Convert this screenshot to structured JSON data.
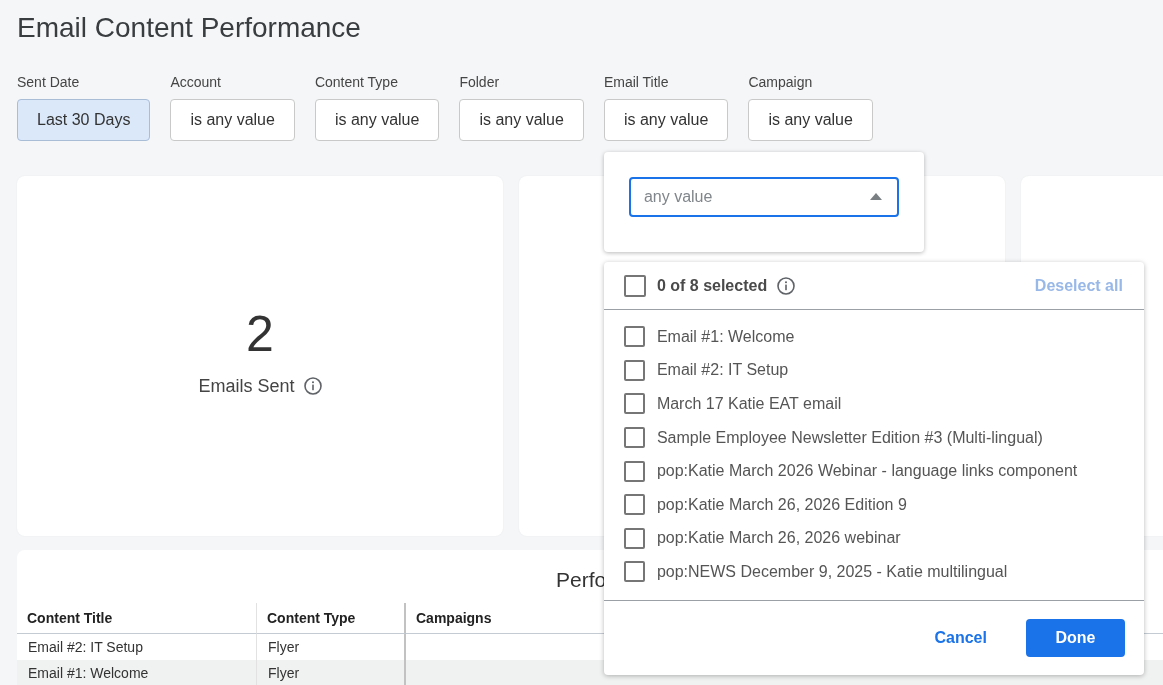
{
  "page": {
    "title": "Email Content Performance"
  },
  "filters": [
    {
      "label": "Sent Date",
      "value": "Last 30 Days",
      "applied": true
    },
    {
      "label": "Account",
      "value": "is any value",
      "applied": false
    },
    {
      "label": "Content Type",
      "value": "is any value",
      "applied": false
    },
    {
      "label": "Folder",
      "value": "is any value",
      "applied": false
    },
    {
      "label": "Email Title",
      "value": "is any value",
      "applied": false,
      "editor": {
        "placeholder": "any value",
        "expanded": true,
        "options_panel": {
          "all_checked": false,
          "summary": "0 of 8 selected",
          "info": true,
          "deselect_all": {
            "label": "Deselect all",
            "disabled": true
          },
          "options": [
            {
              "label": "Email #1: Welcome",
              "checked": false
            },
            {
              "label": "Email #2: IT Setup",
              "checked": false
            },
            {
              "label": "March 17 Katie EAT email",
              "checked": false
            },
            {
              "label": "Sample Employee Newsletter Edition #3 (Multi-lingual)",
              "checked": false
            },
            {
              "label": "pop:Katie March 2026 Webinar - language links component",
              "checked": false
            },
            {
              "label": "pop:Katie March 26, 2026 Edition 9",
              "checked": false
            },
            {
              "label": "pop:Katie March 26, 2026 webinar",
              "checked": false
            },
            {
              "label": "pop:NEWS December 9, 2025 - Katie multilingual",
              "checked": false
            }
          ],
          "buttons": [
            {
              "label": "Cancel",
              "kind": "text"
            },
            {
              "label": "Done",
              "kind": "primary"
            }
          ]
        }
      }
    },
    {
      "label": "Campaign",
      "value": "is any value",
      "applied": false
    }
  ],
  "cards": [
    {
      "kind": "metric",
      "value": "2",
      "label": "Emails Sent",
      "info": true
    },
    {
      "kind": "blank"
    },
    {
      "kind": "blank"
    }
  ],
  "table": {
    "title": "Perfo",
    "columns": [
      "Content Title",
      "Content Type",
      "Campaigns"
    ],
    "rows": [
      {
        "cells": [
          "Email #2: IT Setup",
          "Flyer"
        ]
      },
      {
        "cells": [
          "Email #1: Welcome",
          "Flyer"
        ]
      }
    ]
  }
}
